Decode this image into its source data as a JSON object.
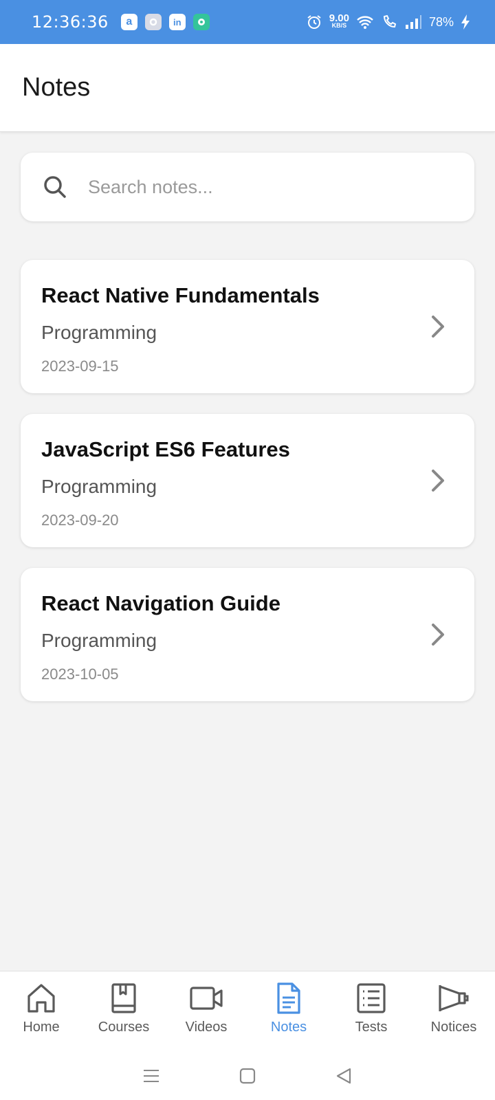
{
  "status_bar": {
    "time": "12:36:36",
    "apps": [
      "a",
      "",
      "in",
      ""
    ],
    "net_speed_value": "9.00",
    "net_speed_unit": "KB/S",
    "battery": "78%"
  },
  "header": {
    "title": "Notes"
  },
  "search": {
    "placeholder": "Search notes...",
    "value": ""
  },
  "notes": [
    {
      "title": "React Native Fundamentals",
      "category": "Programming",
      "date": "2023-09-15"
    },
    {
      "title": "JavaScript ES6 Features",
      "category": "Programming",
      "date": "2023-09-20"
    },
    {
      "title": "React Navigation Guide",
      "category": "Programming",
      "date": "2023-10-05"
    }
  ],
  "bottom_nav": {
    "active": "Notes",
    "accent_color": "#4a90e2",
    "items": [
      {
        "label": "Home",
        "icon": "home-icon"
      },
      {
        "label": "Courses",
        "icon": "book-icon"
      },
      {
        "label": "Videos",
        "icon": "video-camera-icon"
      },
      {
        "label": "Notes",
        "icon": "document-icon"
      },
      {
        "label": "Tests",
        "icon": "list-icon"
      },
      {
        "label": "Notices",
        "icon": "megaphone-icon"
      }
    ]
  },
  "colors": {
    "status_bar": "#4a90e2",
    "background": "#f3f3f3"
  }
}
